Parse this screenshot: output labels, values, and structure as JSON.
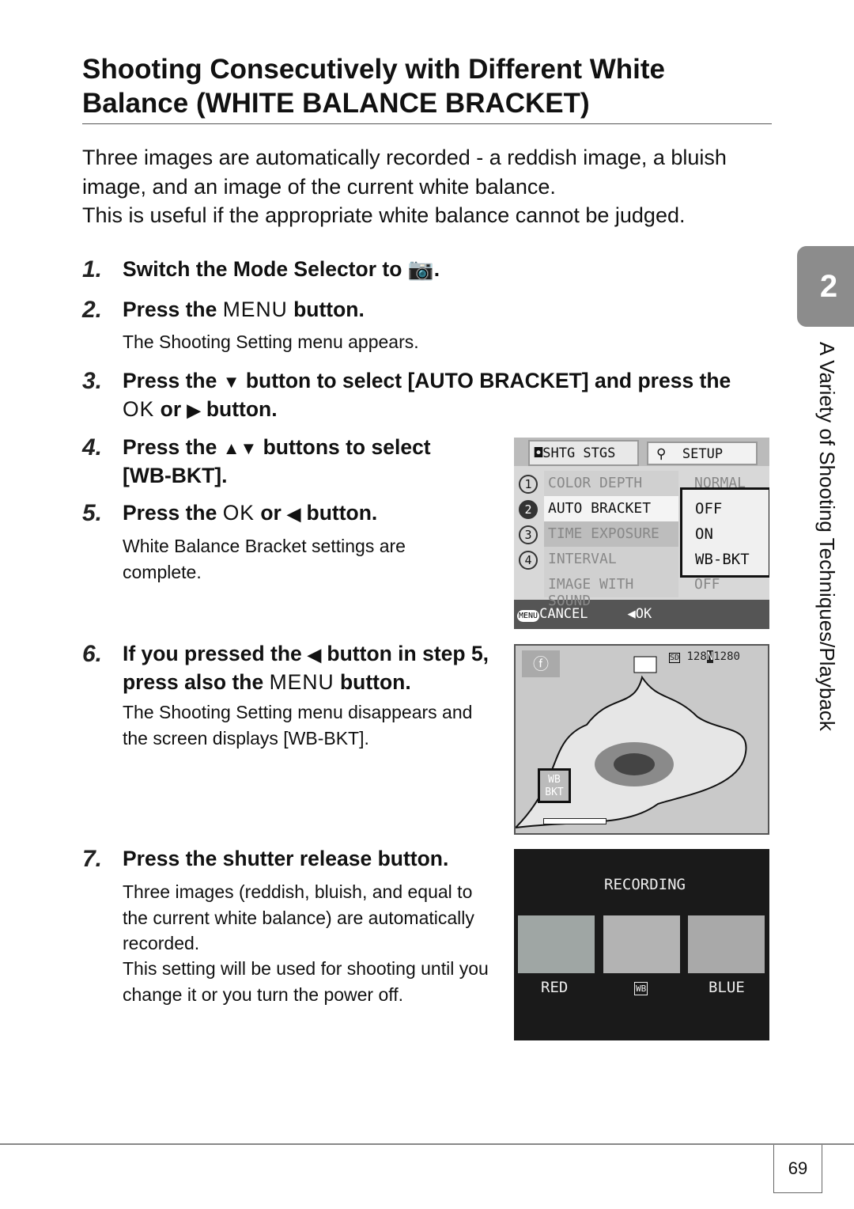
{
  "title": "Shooting Consecutively with Different White Balance (WHITE BALANCE BRACKET)",
  "intro": [
    "Three images are automatically recorded - a reddish image, a bluish image, and an image of the current white balance.",
    "This is useful if the appropriate white balance cannot be judged."
  ],
  "steps": [
    {
      "n": "1.",
      "a": "Switch the Mode Selector to ",
      "b": "."
    },
    {
      "n": "2.",
      "a": "Press the ",
      "menu": "MENU",
      "b": " button.",
      "sub": "The Shooting Setting menu appears."
    },
    {
      "n": "3.",
      "a": "Press the ",
      "b": " button to select [AUTO BRACKET] and press the ",
      "ok": "OK",
      "c": " or ",
      "d": " button."
    },
    {
      "n": "4.",
      "a": "Press the ",
      "b": " buttons to select [WB-BKT]."
    },
    {
      "n": "5.",
      "a": "Press the ",
      "ok": "OK",
      "b": " or ",
      "c": " button.",
      "sub": "White Balance Bracket settings are complete."
    },
    {
      "n": "6.",
      "a": "If you pressed the ",
      "b": " button in step 5, press also the ",
      "menu": "MENU",
      "c": " button.",
      "sub": "The Shooting Setting menu disappears and the screen displays [WB-BKT]."
    },
    {
      "n": "7.",
      "a": "Press the shutter release button.",
      "sub": "Three images (reddish, bluish, and equal to the current white balance) are automatically recorded.",
      "sub2": "This setting will be used for shooting until you change it or you turn the power off."
    }
  ],
  "menu_screen": {
    "tabs": [
      "SHTG STGS",
      "SETUP"
    ],
    "rows": [
      {
        "idx": "1",
        "label": "COLOR DEPTH",
        "value": "NORMAL"
      },
      {
        "idx": "2",
        "label": "AUTO BRACKET",
        "value": ""
      },
      {
        "idx": "3",
        "label": "TIME EXPOSURE",
        "value": ""
      },
      {
        "idx": "4",
        "label": "INTERVAL",
        "value": ""
      },
      {
        "idx": "",
        "label": "IMAGE WITH SOUND",
        "value": "OFF"
      }
    ],
    "options": [
      "OFF",
      "ON",
      "WB-BKT"
    ],
    "footer_cancel": "CANCEL",
    "footer_ok": "OK",
    "menu_icon": "MENU"
  },
  "live_screen": {
    "card": "SD",
    "shots": "128",
    "quality": "N",
    "size": "1280",
    "badge": "WB BKT"
  },
  "rec_screen": {
    "title": "RECORDING",
    "labels": [
      "RED",
      "WB",
      "BLUE"
    ]
  },
  "side_tab": {
    "number": "2",
    "chapter": "A Variety of Shooting Techniques/Playback"
  },
  "page_number": "69"
}
